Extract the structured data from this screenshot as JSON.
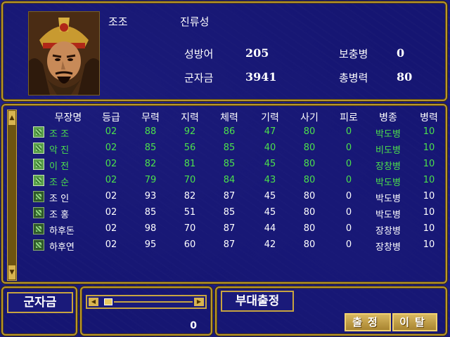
{
  "general": {
    "name": "조조",
    "city": "진류성",
    "defense_label": "성방어",
    "defense_value": "205",
    "gold_label": "군자금",
    "gold_value": "3941",
    "reserve_label": "보충병",
    "reserve_value": "0",
    "total_troops_label": "총병력",
    "total_troops_value": "80"
  },
  "table": {
    "headers": [
      "무장명",
      "등급",
      "무력",
      "지력",
      "체력",
      "기력",
      "사기",
      "피로",
      "병종",
      "병력"
    ],
    "rows": [
      {
        "selected": true,
        "name": "조 조",
        "grade": "02",
        "str": "88",
        "int": "92",
        "hp": "86",
        "energy": "47",
        "morale": "80",
        "fatigue": "0",
        "unit": "박도병",
        "troops": "10"
      },
      {
        "selected": true,
        "name": "악 진",
        "grade": "02",
        "str": "85",
        "int": "56",
        "hp": "85",
        "energy": "40",
        "morale": "80",
        "fatigue": "0",
        "unit": "비도병",
        "troops": "10"
      },
      {
        "selected": true,
        "name": "이 전",
        "grade": "02",
        "str": "82",
        "int": "81",
        "hp": "85",
        "energy": "45",
        "morale": "80",
        "fatigue": "0",
        "unit": "장창병",
        "troops": "10"
      },
      {
        "selected": true,
        "name": "조 순",
        "grade": "02",
        "str": "79",
        "int": "70",
        "hp": "84",
        "energy": "43",
        "morale": "80",
        "fatigue": "0",
        "unit": "박도병",
        "troops": "10"
      },
      {
        "selected": false,
        "name": "조 인",
        "grade": "02",
        "str": "93",
        "int": "82",
        "hp": "87",
        "energy": "45",
        "morale": "80",
        "fatigue": "0",
        "unit": "박도병",
        "troops": "10"
      },
      {
        "selected": false,
        "name": "조 홍",
        "grade": "02",
        "str": "85",
        "int": "51",
        "hp": "85",
        "energy": "45",
        "morale": "80",
        "fatigue": "0",
        "unit": "박도병",
        "troops": "10"
      },
      {
        "selected": false,
        "name": "하후돈",
        "grade": "02",
        "str": "98",
        "int": "70",
        "hp": "87",
        "energy": "44",
        "morale": "80",
        "fatigue": "0",
        "unit": "장창병",
        "troops": "10"
      },
      {
        "selected": false,
        "name": "하후연",
        "grade": "02",
        "str": "95",
        "int": "60",
        "hp": "87",
        "energy": "42",
        "morale": "80",
        "fatigue": "0",
        "unit": "장창병",
        "troops": "10"
      }
    ]
  },
  "bottom": {
    "gold_button": "군자금",
    "gold_amount": "0",
    "deploy_label": "부대출정",
    "deploy_button": "출정",
    "leave_button": "이탈"
  },
  "colors": {
    "selected_text": "#4ce04c",
    "normal_text": "#ffffff",
    "frame_gold": "#b8962e",
    "background": "#181878"
  }
}
